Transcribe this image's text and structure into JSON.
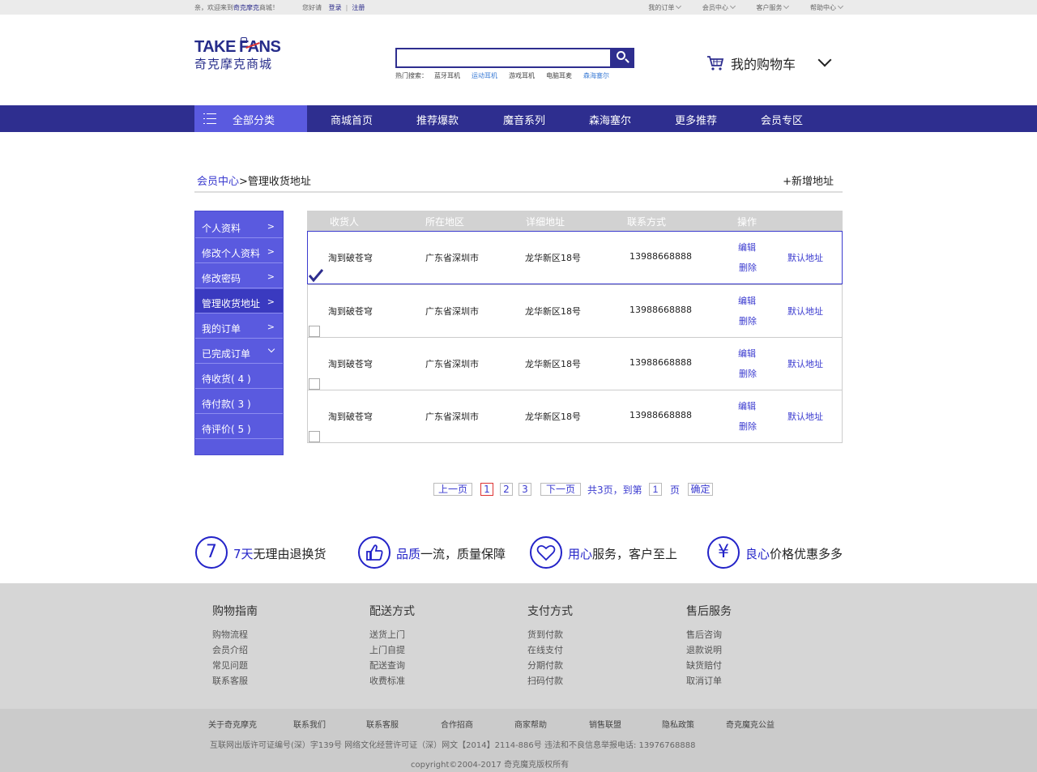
{
  "topbar": {
    "welcome_prefix": "亲，欢迎来到",
    "brand": "奇克摩克",
    "welcome_suffix": "商城！",
    "greeting": "您好请",
    "login": "登录",
    "register": "注册",
    "right_items": [
      "我的订单",
      "会员中心",
      "客户服务",
      "帮助中心"
    ]
  },
  "logo": {
    "en_take": "TAKE",
    "en_fans": "FANS",
    "cn": "奇克摩克商城"
  },
  "search": {
    "value": "",
    "placeholder": "",
    "hot_label": "热门搜索：",
    "hot_items": [
      "蓝牙耳机",
      "运动耳机",
      "游戏耳机",
      "电脑耳麦",
      "森海塞尔"
    ]
  },
  "cart": {
    "label": "我的购物车"
  },
  "nav": {
    "all_label": "全部分类",
    "items": [
      "商城首页",
      "推荐爆款",
      "魔音系列",
      "森海塞尔",
      "更多推荐",
      "会员专区"
    ]
  },
  "breadcrumb": {
    "parent": "会员中心",
    "sep": ">",
    "current": "管理收货地址"
  },
  "add_address": "+新增地址",
  "sidebar": {
    "items": [
      {
        "label": "个人资料",
        "arrow": ">"
      },
      {
        "label": "修改个人资料",
        "arrow": ">"
      },
      {
        "label": "修改密码",
        "arrow": ">"
      },
      {
        "label": "管理收货地址",
        "arrow": ">"
      },
      {
        "label": "我的订单",
        "arrow": ">"
      },
      {
        "label": "已完成订单",
        "arrow": ""
      },
      {
        "label": "待收货( 4 )",
        "arrow": ""
      },
      {
        "label": "待付款( 3 )",
        "arrow": ""
      },
      {
        "label": "待评价( 5 )",
        "arrow": ""
      }
    ]
  },
  "table": {
    "headers": [
      "收货人",
      "所在地区",
      "详细地址",
      "联系方式",
      "操作"
    ],
    "rows": [
      {
        "name": "淘到破苍穹",
        "region": "广东省深圳市",
        "address": "龙华新区18号",
        "phone": "13988668888",
        "edit": "编辑",
        "delete": "删除",
        "default": "默认地址",
        "checked": true
      },
      {
        "name": "淘到破苍穹",
        "region": "广东省深圳市",
        "address": "龙华新区18号",
        "phone": "13988668888",
        "edit": "编辑",
        "delete": "删除",
        "default": "默认地址",
        "checked": false
      },
      {
        "name": "淘到破苍穹",
        "region": "广东省深圳市",
        "address": "龙华新区18号",
        "phone": "13988668888",
        "edit": "编辑",
        "delete": "删除",
        "default": "默认地址",
        "checked": false
      },
      {
        "name": "淘到破苍穹",
        "region": "广东省深圳市",
        "address": "龙华新区18号",
        "phone": "13988668888",
        "edit": "编辑",
        "delete": "删除",
        "default": "默认地址",
        "checked": false
      }
    ]
  },
  "pagination": {
    "prev": "上一页",
    "pages": [
      "1",
      "2",
      "3"
    ],
    "current_page": "1",
    "next": "下一页",
    "total_text": "共3页，到第",
    "goto_value": "1",
    "page_unit": "页",
    "confirm": "确定"
  },
  "promises": [
    {
      "glyph": "7",
      "hl": "7天",
      "rest": "无理由退换货"
    },
    {
      "glyph": "",
      "hl": "品质",
      "rest": "一流，质量保障"
    },
    {
      "glyph": "",
      "hl": "用心",
      "rest": "服务，客户至上"
    },
    {
      "glyph": "¥",
      "hl": "良心",
      "rest": "价格优惠多多"
    }
  ],
  "footer": {
    "columns": [
      {
        "title": "购物指南",
        "links": [
          "购物流程",
          "会员介绍",
          "常见问题",
          "联系客服"
        ]
      },
      {
        "title": "配送方式",
        "links": [
          "送货上门",
          "上门自提",
          "配送查询",
          "收费标准"
        ]
      },
      {
        "title": "支付方式",
        "links": [
          "货到付款",
          "在线支付",
          "分期付款",
          "扫码付款"
        ]
      },
      {
        "title": "售后服务",
        "links": [
          "售后咨询",
          "退款说明",
          "缺货赔付",
          "取消订单"
        ]
      }
    ],
    "bottom_links": [
      "关于奇克摩克",
      "联系我们",
      "联系客服",
      "合作招商",
      "商家帮助",
      "销售联盟",
      "隐私政策",
      "奇克魔克公益"
    ],
    "license": "互联网出版许可证编号(深）字139号    网络文化经营许可证（深）网文【2014】2114-886号    违法和不良信息举报电话: 13976768888",
    "copyright": "copyright©2004-2017 奇克魔克版权所有"
  },
  "colors": {
    "primary": "#2e2e8f",
    "accent": "#5a5adf",
    "link": "#3a3acf"
  }
}
